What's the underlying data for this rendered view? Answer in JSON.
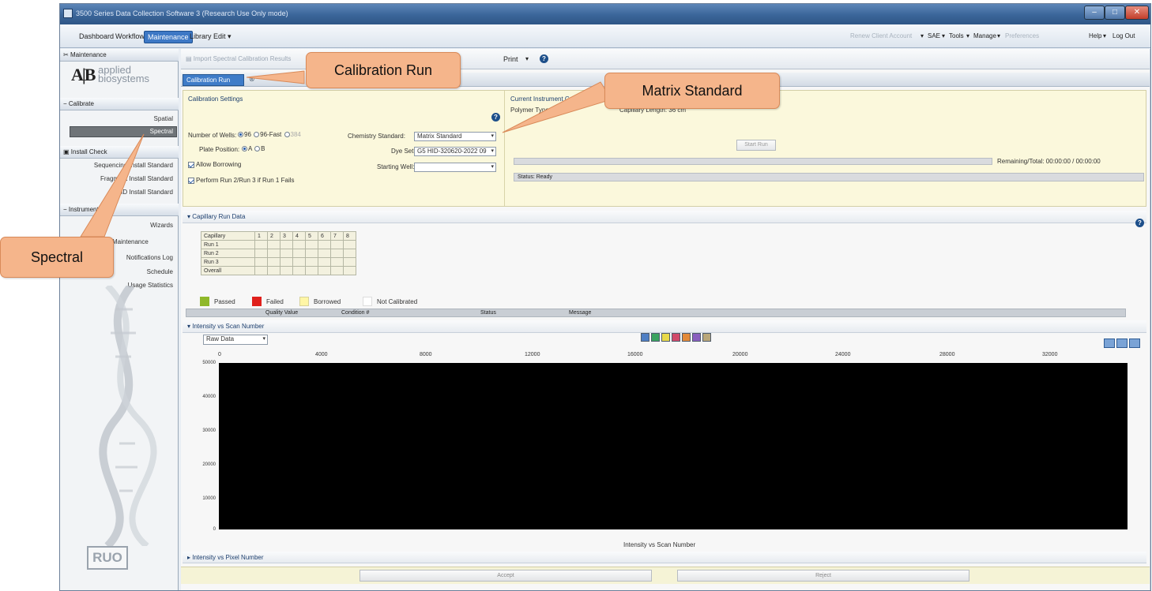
{
  "window": {
    "title": "3500 Series Data Collection Software 3 (Research Use Only mode)",
    "controls": [
      "–",
      "□",
      "✕"
    ]
  },
  "menubar": {
    "tabs": [
      "Dashboard",
      "Workflow",
      "Maintenance",
      "Library",
      "Edit ▾"
    ],
    "right": [
      "Renew Client Account",
      "▾",
      "SAE",
      "▾",
      "Tools",
      "▾",
      "Manage",
      "▾",
      "Preferences",
      "Help",
      "▾",
      "Log Out"
    ]
  },
  "left": {
    "header": "Maintenance",
    "logo": {
      "mark": "A|B",
      "line1": "applied",
      "line2": "biosystems"
    },
    "calibrate_head": "Calibrate",
    "calibrate_items": [
      "Spatial",
      "Spectral"
    ],
    "install_head": "Install Check",
    "install_items": [
      "Sequencing Install Standard",
      "Fragment Install Standard",
      "HID Install Standard"
    ],
    "service_head": "Instrument",
    "service_items": [
      "Wizards",
      "Maintenance",
      "Notifications Log",
      "Schedule",
      "Usage Statistics"
    ],
    "ruo": "RUO"
  },
  "toolbar": {
    "import": "Import Spectral Calibration Results",
    "print": "Print",
    "tab": "Calibration Run"
  },
  "settings": {
    "title": "Calibration Settings",
    "wells_label": "Number of Wells:",
    "wells_opts": [
      "96",
      "96-Fast",
      "384"
    ],
    "plate_label": "Plate Position:",
    "plate_opts": [
      "A",
      "B"
    ],
    "allow_borrowing": "Allow Borrowing",
    "perform_runs": "Perform Run 2/Run 3 if Run 1 Fails",
    "chem_label": "Chemistry Standard:",
    "chem_value": "Matrix Standard",
    "dye_label": "Dye Set:",
    "dye_value": "G5 HID-320620-2022 09",
    "well_label": "Starting Well:",
    "well_value": ""
  },
  "instrument": {
    "title": "Current Instrument Conditions",
    "polymer": "Polymer Type:",
    "capillary": "Capillary Length: 36 cm",
    "start": "Start Run",
    "remaining": "Remaining/Total: 00:00:00 / 00:00:00",
    "status": "Status: Ready"
  },
  "capillary": {
    "title": "Capillary Run Data",
    "cols": [
      "Capillary",
      "1",
      "2",
      "3",
      "4",
      "5",
      "6",
      "7",
      "8"
    ],
    "rows": [
      "Run 1",
      "Run 2",
      "Run 3",
      "Overall"
    ],
    "legend": [
      {
        "label": "Passed",
        "color": "#8fb82a"
      },
      {
        "label": "Failed",
        "color": "#e0201c"
      },
      {
        "label": "Borrowed",
        "color": "#fff6a6"
      },
      {
        "label": "Not Calibrated",
        "color": "#ffffff"
      }
    ],
    "grid_cols": [
      "Quality Value",
      "Condition #",
      "Status",
      "Message"
    ]
  },
  "intensity": {
    "title": "Intensity vs Scan Number",
    "select": "Raw Data",
    "xticks": [
      "0",
      "4000",
      "8000",
      "12000",
      "16000",
      "20000",
      "24000",
      "28000",
      "32000"
    ],
    "yticks": [
      "50000",
      "40000",
      "30000",
      "20000",
      "10000",
      "0"
    ],
    "xlabel": "Intensity vs Scan Number",
    "dye_colors": [
      "#4f7fc4",
      "#3aa360",
      "#e8d94a",
      "#d14a6a",
      "#e38a3a",
      "#8a5fbf",
      "#b9a77a"
    ]
  },
  "pixel": {
    "title": "Intensity vs Pixel Number"
  },
  "footer": {
    "accept": "Accept",
    "reject": "Reject"
  },
  "callouts": {
    "calibration_run": "Calibration Run",
    "matrix_standard": "Matrix Standard",
    "spectral": "Spectral"
  }
}
